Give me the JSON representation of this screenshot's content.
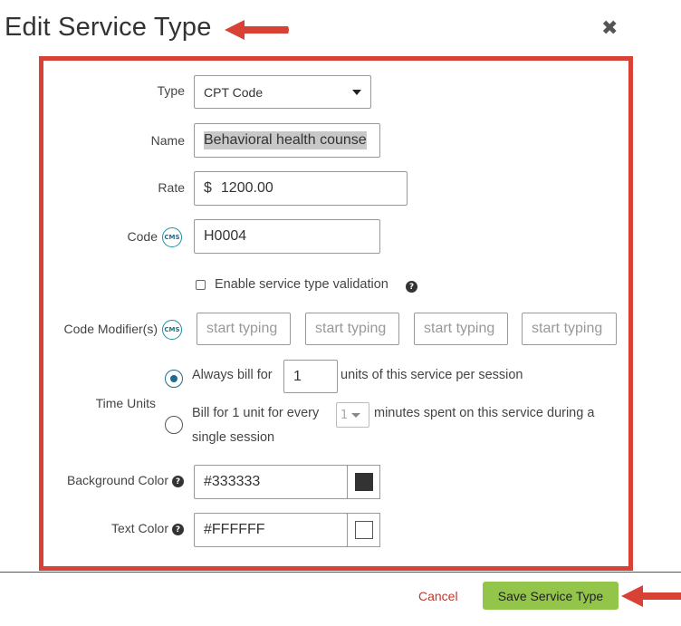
{
  "dialog": {
    "title": "Edit Service Type",
    "close_icon": "close-icon"
  },
  "form": {
    "type": {
      "label": "Type",
      "value": "CPT Code"
    },
    "name": {
      "label": "Name",
      "value": "Behavioral health counse"
    },
    "rate": {
      "label": "Rate",
      "currency": "$",
      "value": "1200.00"
    },
    "code": {
      "label": "Code",
      "badge": "CMS",
      "value": "H0004"
    },
    "validation": {
      "label": "Enable service type validation",
      "checked": false
    },
    "code_modifiers": {
      "label": "Code Modifier(s)",
      "badge": "CMS",
      "placeholders": [
        "start typing",
        "start typing",
        "start typing",
        "start typing"
      ]
    },
    "time_units": {
      "label": "Time Units",
      "option1": {
        "prefix": "Always bill for",
        "units_value": "1",
        "suffix": "units of this service per session",
        "selected": true
      },
      "option2": {
        "prefix": "Bill for 1 unit for every",
        "minutes_value": "1",
        "suffix": "minutes spent on this service during a",
        "suffix_line2": "single session",
        "selected": false
      }
    },
    "background_color": {
      "label": "Background Color",
      "value": "#333333",
      "swatch": "#333333"
    },
    "text_color": {
      "label": "Text Color",
      "value": "#FFFFFF",
      "swatch": "#FFFFFF"
    }
  },
  "footer": {
    "cancel_label": "Cancel",
    "save_label": "Save Service Type"
  },
  "colors": {
    "annotation_red": "#d84136",
    "save_green": "#92c54a",
    "cms_teal": "#1b8fa6",
    "cancel_red": "#c0392b"
  }
}
